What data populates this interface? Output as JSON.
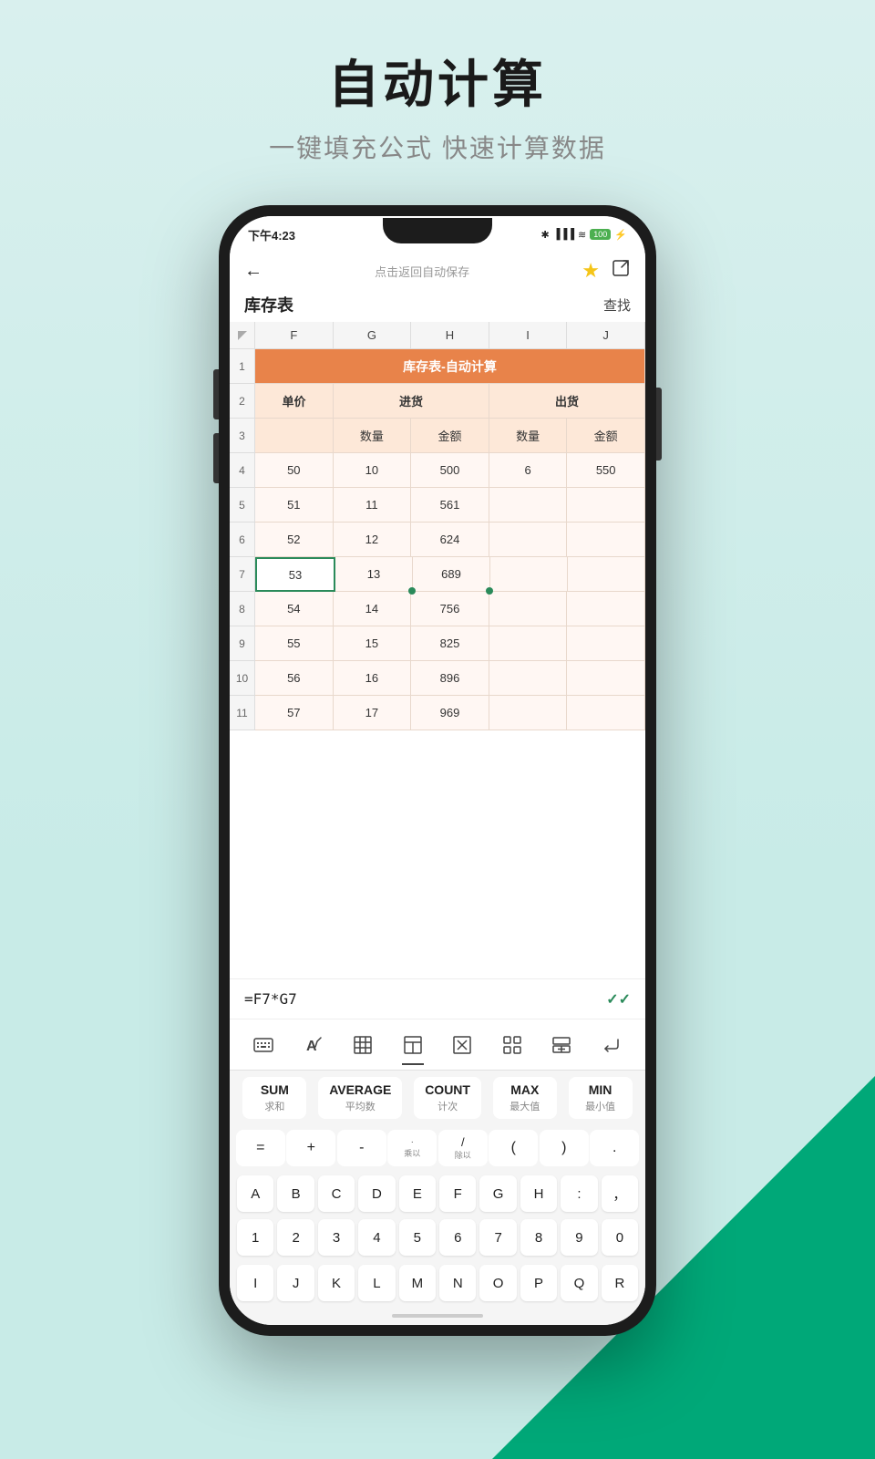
{
  "page": {
    "bg_color_top": "#d9f0ee",
    "bg_color_bottom": "#c8ebe7",
    "bg_accent": "#00a878"
  },
  "title": {
    "main": "自动计算",
    "sub": "一键填充公式 快速计算数据"
  },
  "status_bar": {
    "time": "下午4:23",
    "icons": "✶ ⏰ 🟢 ✱ ▓▓▓ ᵂ ≋ 🔋"
  },
  "app_header": {
    "back_label": "←",
    "center_label": "点击返回自动保存",
    "star_label": "★",
    "export_label": "⬡"
  },
  "doc_bar": {
    "title": "库存表",
    "find": "查找"
  },
  "spreadsheet": {
    "col_headers": [
      "F",
      "G",
      "H",
      "I",
      "J"
    ],
    "rows": [
      {
        "num": "1",
        "cells": [
          {
            "text": "库存表-自动计算",
            "span": 5,
            "type": "header-orange"
          }
        ]
      },
      {
        "num": "2",
        "cells": [
          {
            "text": "单价",
            "type": "subheader"
          },
          {
            "text": "进货",
            "span": 2,
            "type": "subheader"
          },
          {
            "text": "",
            "type": "subheader"
          },
          {
            "text": "出货",
            "span": 2,
            "type": "subheader"
          },
          {
            "text": "",
            "type": "subheader"
          }
        ]
      },
      {
        "num": "3",
        "cells": [
          {
            "text": "",
            "type": "col-label"
          },
          {
            "text": "数量",
            "type": "col-label"
          },
          {
            "text": "金额",
            "type": "col-label"
          },
          {
            "text": "数量",
            "type": "col-label"
          },
          {
            "text": "金额",
            "type": "col-label"
          }
        ]
      },
      {
        "num": "4",
        "cells": [
          {
            "text": "50"
          },
          {
            "text": "10"
          },
          {
            "text": "500"
          },
          {
            "text": "6"
          },
          {
            "text": "550"
          }
        ]
      },
      {
        "num": "5",
        "cells": [
          {
            "text": "51"
          },
          {
            "text": "11"
          },
          {
            "text": "561"
          },
          {
            "text": ""
          },
          {
            "text": ""
          }
        ]
      },
      {
        "num": "6",
        "cells": [
          {
            "text": "52"
          },
          {
            "text": "12"
          },
          {
            "text": "624"
          },
          {
            "text": ""
          },
          {
            "text": ""
          }
        ]
      },
      {
        "num": "7",
        "cells": [
          {
            "text": "53",
            "type": "selected"
          },
          {
            "text": "13"
          },
          {
            "text": "689"
          },
          {
            "text": ""
          },
          {
            "text": ""
          }
        ]
      },
      {
        "num": "8",
        "cells": [
          {
            "text": "54"
          },
          {
            "text": "14"
          },
          {
            "text": "756"
          },
          {
            "text": ""
          },
          {
            "text": ""
          }
        ]
      },
      {
        "num": "9",
        "cells": [
          {
            "text": "55"
          },
          {
            "text": "15"
          },
          {
            "text": "825"
          },
          {
            "text": ""
          },
          {
            "text": ""
          }
        ]
      },
      {
        "num": "10",
        "cells": [
          {
            "text": "56"
          },
          {
            "text": "16"
          },
          {
            "text": "896"
          },
          {
            "text": ""
          },
          {
            "text": ""
          }
        ]
      },
      {
        "num": "11",
        "cells": [
          {
            "text": "57"
          },
          {
            "text": "17"
          },
          {
            "text": "969"
          },
          {
            "text": ""
          },
          {
            "text": ""
          }
        ]
      }
    ]
  },
  "formula_bar": {
    "formula": "=F7*G7",
    "check": "✓✓"
  },
  "toolbar": {
    "icons": [
      "⌨",
      "A↑",
      "⊞",
      "⊡",
      "⊠",
      "⠿",
      "⊏",
      "↵"
    ]
  },
  "func_row": {
    "buttons": [
      {
        "main": "SUM",
        "sub": "求和"
      },
      {
        "main": "AVERAGE",
        "sub": "平均数"
      },
      {
        "main": "COUNT",
        "sub": "计次"
      },
      {
        "main": "MAX",
        "sub": "最大值"
      },
      {
        "main": "MIN",
        "sub": "最小值"
      }
    ]
  },
  "op_row": {
    "keys": [
      {
        "main": "=",
        "sub": ""
      },
      {
        "main": "+",
        "sub": ""
      },
      {
        "main": "-",
        "sub": ""
      },
      {
        "main": "·",
        "sub": "乘以"
      },
      {
        "main": "/",
        "sub": "除以"
      },
      {
        "main": "(",
        "sub": ""
      },
      {
        "main": ")",
        "sub": ""
      },
      {
        "main": ".",
        "sub": ""
      }
    ]
  },
  "letter_rows": [
    [
      "A",
      "B",
      "C",
      "D",
      "E",
      "F",
      "G",
      "H",
      ":",
      "，"
    ],
    [
      "1",
      "2",
      "3",
      "4",
      "5",
      "6",
      "7",
      "8",
      "9",
      "0"
    ],
    [
      "I",
      "J",
      "K",
      "L",
      "M",
      "N",
      "O",
      "P",
      "Q",
      "R"
    ]
  ]
}
